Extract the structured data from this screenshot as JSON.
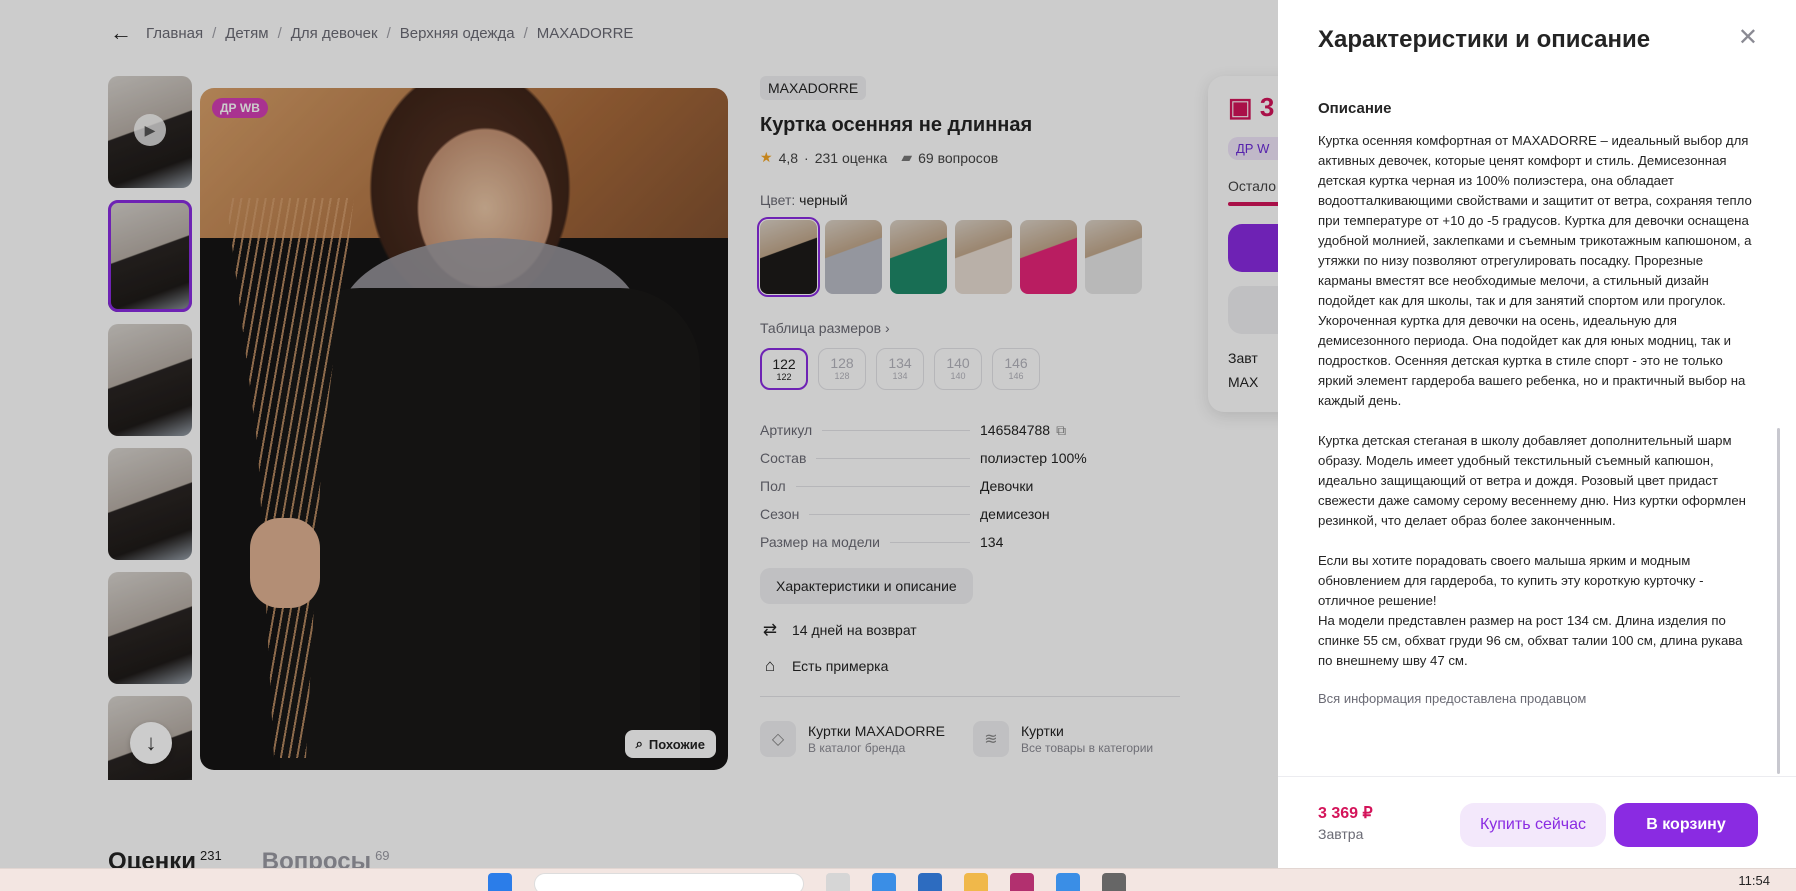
{
  "breadcrumbs": [
    "Главная",
    "Детям",
    "Для девочек",
    "Верхняя одежда",
    "MAXADORRE"
  ],
  "gallery": {
    "badge": "ДР WB",
    "similar_label": "Похожие"
  },
  "product": {
    "brand": "MAXADORRE",
    "title": "Куртка осенняя не длинная",
    "rating": "4,8",
    "reviews": "231 оценка",
    "questions": "69 вопросов",
    "color_label": "Цвет:",
    "color_value": "черный",
    "swatch_colors": [
      "#1d1b1a",
      "#b9bcc6",
      "#1f8a6a",
      "#e8dcd2",
      "#e8257a",
      "#e7e6e6"
    ],
    "size_table_label": "Таблица размеров",
    "sizes": [
      {
        "main": "122",
        "sub": "122",
        "selected": true
      },
      {
        "main": "128",
        "sub": "128",
        "selected": false
      },
      {
        "main": "134",
        "sub": "134",
        "selected": false
      },
      {
        "main": "140",
        "sub": "140",
        "selected": false
      },
      {
        "main": "146",
        "sub": "146",
        "selected": false
      }
    ],
    "specs": [
      {
        "k": "Артикул",
        "v": "146584788"
      },
      {
        "k": "Состав",
        "v": "полиэстер 100%"
      },
      {
        "k": "Пол",
        "v": "Девочки"
      },
      {
        "k": "Сезон",
        "v": "демисезон"
      },
      {
        "k": "Размер на модели",
        "v": "134"
      }
    ],
    "chars_button": "Характеристики и описание",
    "return_text": "14 дней на возврат",
    "fitting_text": "Есть примерка",
    "cat_brand_name": "Куртки MAXADORRE",
    "cat_brand_sub": "В каталог бренда",
    "cat_all_name": "Куртки",
    "cat_all_sub": "Все товары в категории"
  },
  "buybox": {
    "price_partial": "3",
    "dr_partial": "ДР W",
    "left_partial": "Остало",
    "delivery_partial": "Завт",
    "seller_partial": "MAX"
  },
  "bottom_tabs": {
    "reviews_label": "Оценки",
    "reviews_count": "231",
    "questions_label": "Вопросы",
    "questions_count": "69"
  },
  "drawer": {
    "title": "Характеристики и описание",
    "section_title": "Описание",
    "paragraphs": [
      "Куртка осенняя комфортная от MAXADORRE – идеальный выбор для активных девочек, которые ценят комфорт и стиль. Демисезонная детская куртка черная из 100% полиэстера, она обладает водоотталкивающими свойствами и защитит от ветра, сохраняя тепло при температуре от +10 до -5 градусов. Куртка для девочки оснащена удобной молнией, заклепками и съемным трикотажным капюшоном, а утяжки по низу позволяют отрегулировать посадку. Прорезные карманы вместят все необходимые мелочи, а стильный дизайн подойдет как для школы, так и для занятий спортом или прогулок. Укороченная куртка для девочки на осень, идеальную для демисезонного периода. Она подойдет как для юных модниц, так и подростков. Осенняя детская куртка в стиле спорт - это не только яркий элемент гардероба вашего ребенка, но и практичный выбор на каждый день.",
      "Куртка детская стеганая в школу добавляет дополнительный шарм образу. Модель имеет удобный текстильный съемный капюшон, идеально защищающий от ветра и дождя. Розовый цвет придаст свежести даже самому серому весеннему дню. Низ куртки оформлен резинкой, что делает образ более законченным.",
      "Если вы хотите порадовать своего малыша ярким и модным обновлением для гардероба, то купить эту короткую курточку - отличное решение!",
      "На модели представлен размер на рост 134 см. Длина изделия по спинке 55 см, обхват груди 96 см, обхват талии 100 см, длина рукава по внешнему шву 47 см."
    ],
    "note": "Вся информация предоставлена продавцом",
    "price": "3 369 ₽",
    "delivery": "Завтра",
    "buy_now": "Купить сейчас",
    "add_to_cart": "В корзину"
  },
  "taskbar": {
    "time": "11:54"
  }
}
